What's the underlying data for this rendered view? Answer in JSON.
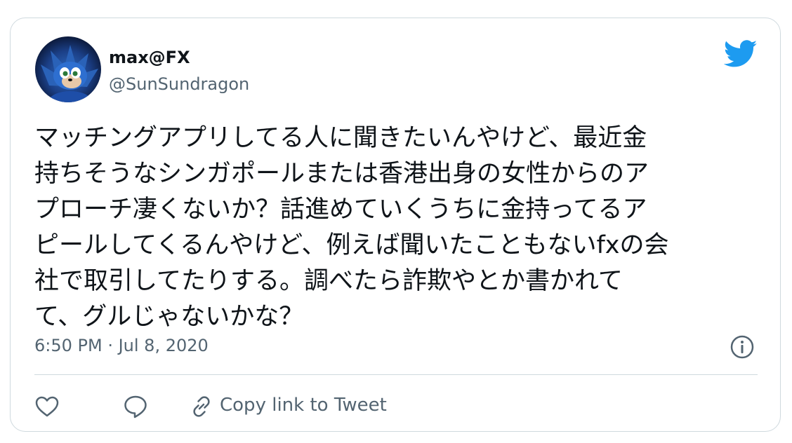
{
  "tweet": {
    "display_name": "max@FX",
    "handle": "@SunSundragon",
    "text_lines": [
      "マッチングアプリしてる人に聞きたいんやけど、最近金",
      "持ちそうなシンガポールまたは香港出身の女性からのア",
      "プローチ凄くないか？話進めていくうちに金持ってるア",
      "ピールしてくるんやけど、例えば聞いたこともないfxの会",
      "社で取引してたりする。調べたら詐欺やとか書かれて",
      "て、グルじゃないかな？"
    ],
    "timestamp": "6:50 PM · Jul 8, 2020",
    "copy_link_label": "Copy link to Tweet"
  },
  "icons": {
    "brand": "twitter-bird-icon",
    "info": "info-icon",
    "like": "heart-icon",
    "reply": "speech-bubble-icon",
    "link": "link-icon"
  },
  "colors": {
    "twitter_blue": "#1d9bf0",
    "text": "#0f1419",
    "muted": "#536471",
    "border": "#cfd9de"
  }
}
